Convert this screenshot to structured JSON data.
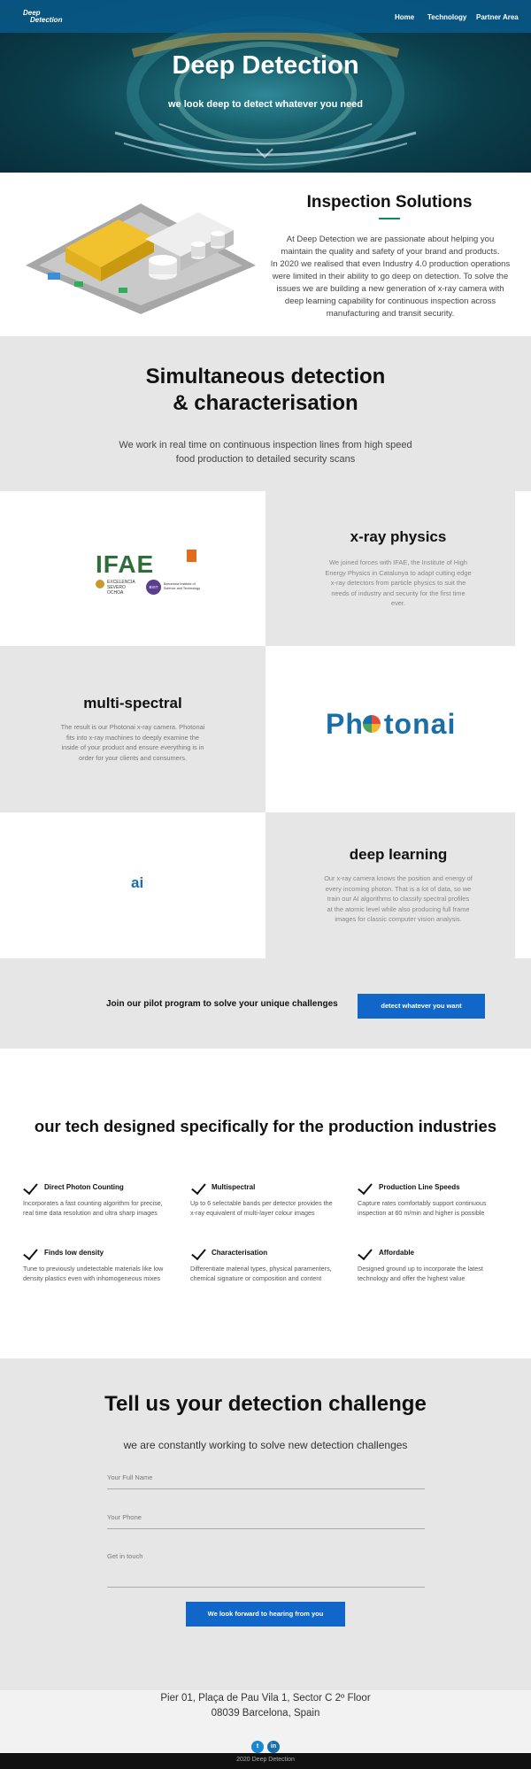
{
  "nav": {
    "logo_line1": "Deep",
    "logo_line2": "Detection",
    "links": [
      "Home",
      "Technology",
      "Partner Area"
    ]
  },
  "hero": {
    "title": "Deep Detection",
    "subtitle": "we look deep to detect whatever you need"
  },
  "inspection": {
    "title": "Inspection Solutions",
    "lines": [
      "At Deep Detection we are passionate about helping you",
      "maintain the quality and safety of your brand and products.",
      "In 2020 we realised that even Industry 4.0 production operations",
      "were limited in their ability to go deep on detection. To solve the",
      "issues we are building a new generation of x-ray camera with",
      "deep learning capability for continuous inspection across",
      "manufacturing and transit security."
    ]
  },
  "simultaneous": {
    "title_line1": "Simultaneous detection",
    "title_line2": "& characterisation",
    "sub_line1": "We work in real time on continuous inspection lines from high speed",
    "sub_line2": "food production to detailed security scans"
  },
  "xray": {
    "title": "x-ray physics",
    "lines": [
      "We joined forces with IFAE, the Institute of High",
      "Energy Physics in Catalunya to adapt cutting edge",
      "x-ray detectors from particle physics to suit the",
      "needs of industry and security for the first time",
      "ever."
    ],
    "logo": {
      "main": "IFAE",
      "sub1": "EXCELENCIA",
      "sub2": "SEVERO",
      "sub3": "OCHOA",
      "bist": "BIST",
      "bist_text1": "Barcelona Institute of",
      "bist_text2": "Science and Technology"
    }
  },
  "multispectral": {
    "title": "multi-spectral",
    "lines": [
      "The result is our Photonai x-ray camera. Photonai",
      "fits into x-ray machines to deeply examine the",
      "inside of your product and ensure everything is in",
      "order for your clients and consumers."
    ],
    "logo_text_a": "Ph",
    "logo_text_b": "tonai"
  },
  "deeplearning": {
    "title": "deep learning",
    "lines": [
      "Our x-ray camera knows the position and energy of",
      "every incoming photon. That is a lot of data, so we",
      "train our AI algorithms to classify spectral profiles",
      "at the atomic level while also producing full frame",
      "images for classic computer vision analysis."
    ],
    "ai_logo": "ai"
  },
  "pilot": {
    "text": "Join our pilot program to solve your unique challenges",
    "button": "detect whatever you want"
  },
  "tech": {
    "title": "our tech designed specifically for the production industries",
    "features": [
      {
        "title": "Direct Photon Counting",
        "line1": "Incorporates a fast counting algorithm for precise,",
        "line2": "real time data resolution and ultra sharp images"
      },
      {
        "title": "Multispectral",
        "line1": "Up to 6 selectable bands per detector provides the",
        "line2": "x-ray equivalent of multi-layer colour images"
      },
      {
        "title": "Production Line Speeds",
        "line1": "Capture rates comfortably support continuous",
        "line2": "inspection at 60 m/min and higher is possible"
      },
      {
        "title": "Finds low density",
        "line1": "Tune to previously undetectable materials like low",
        "line2": "density plastics even with inhomogeneous mixes"
      },
      {
        "title": "Characterisation",
        "line1": "Differentiate material types, physical paramenters,",
        "line2": "chemical signature or composition and content"
      },
      {
        "title": "Affordable",
        "line1": "Designed ground up to incorporate the latest",
        "line2": "technology and offer the highest value"
      }
    ]
  },
  "contact": {
    "title": "Tell us your detection challenge",
    "subtitle": "we are constantly working to solve new detection challenges",
    "name_placeholder": "Your Full Name",
    "phone_placeholder": "Your Phone",
    "message_placeholder": "Get in touch",
    "submit": "We look forward to hearing from you"
  },
  "footer": {
    "address1": "Pier 01, Plaça de Pau Vila 1, Sector C 2º Floor",
    "address2": "08039 Barcelona, Spain",
    "twitter": "t",
    "linkedin": "in",
    "copyright": "2020 Deep Detection"
  },
  "colors": {
    "accent": "#1166c9",
    "green": "#0c8a63",
    "grey_bg": "#e6e6e6"
  }
}
